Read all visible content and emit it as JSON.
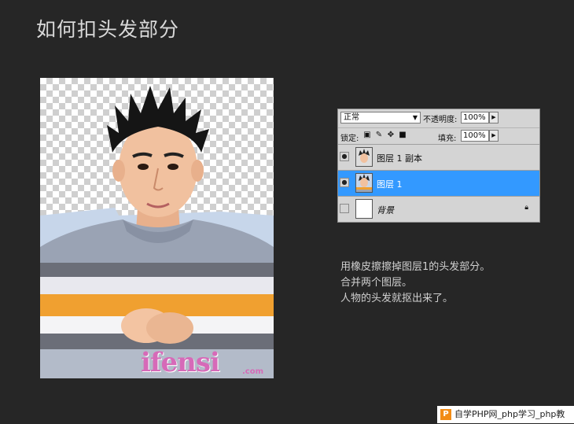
{
  "slide": {
    "title": "如何扣头发部分"
  },
  "photo": {
    "watermark": "ifensi",
    "watermark_suffix": ".com"
  },
  "layers_panel": {
    "blend_mode": "正常",
    "opacity_label": "不透明度:",
    "opacity_value": "100%",
    "lock_label": "锁定:",
    "fill_label": "填充:",
    "fill_value": "100%",
    "layers": [
      {
        "name": "图层 1 副本",
        "visible": true,
        "selected": false
      },
      {
        "name": "图层 1",
        "visible": true,
        "selected": true
      },
      {
        "name": "背景",
        "visible": false,
        "selected": false
      }
    ]
  },
  "description": {
    "lines": [
      "用橡皮擦擦掉图层1的头发部分。",
      "合并两个图层。",
      "人物的头发就抠出来了。"
    ]
  },
  "footer": {
    "icon": "P",
    "text": "自学PHP网_php学习_php教"
  },
  "colors": {
    "background": "#262626",
    "selection": "#3399ff"
  }
}
